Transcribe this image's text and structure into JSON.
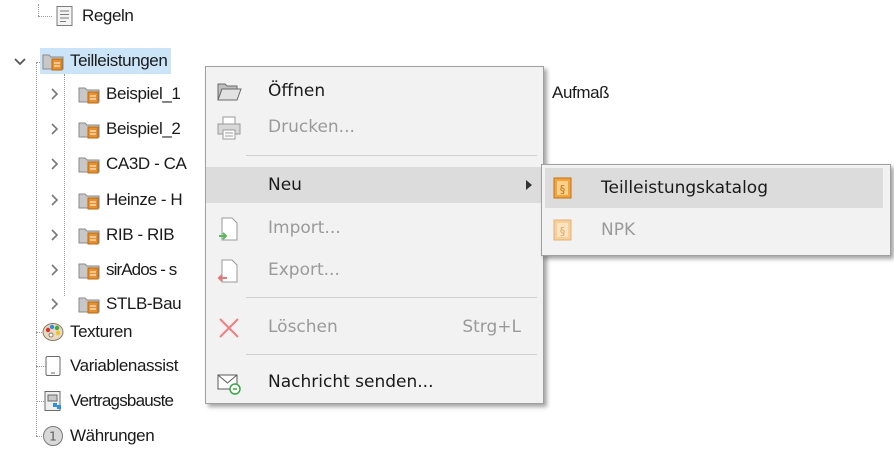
{
  "tree": {
    "items": [
      {
        "label": "Regeln",
        "icon": "rules-icon"
      },
      {
        "label": "Teilleistungen",
        "icon": "folder-icon",
        "selected": true,
        "expanded": true
      },
      {
        "label": "Beispiel_1",
        "icon": "folder-icon"
      },
      {
        "label": "Beispiel_2",
        "icon": "folder-icon"
      },
      {
        "label": "CA3D - CA",
        "icon": "folder-icon"
      },
      {
        "label": "Heinze - H",
        "icon": "folder-icon"
      },
      {
        "label": "RIB - RIB",
        "icon": "folder-icon"
      },
      {
        "label": "sirAdos - s",
        "icon": "folder-icon"
      },
      {
        "label": "STLB-Bau",
        "icon": "folder-icon"
      },
      {
        "label": "Texturen",
        "icon": "palette-icon"
      },
      {
        "label": "Variablenassist",
        "icon": "tablet-icon"
      },
      {
        "label": "Vertragsbauste",
        "icon": "contract-icon"
      },
      {
        "label": "Währungen",
        "icon": "currency-icon"
      }
    ],
    "background_text": "Aufmaß"
  },
  "context_menu": {
    "items": [
      {
        "label": "Öffnen",
        "icon": "open-folder-icon",
        "disabled": false
      },
      {
        "label": "Drucken...",
        "icon": "printer-icon",
        "disabled": true
      },
      {
        "label": "Neu",
        "disabled": false,
        "highlighted": true,
        "has_submenu": true
      },
      {
        "label": "Import...",
        "icon": "import-icon",
        "disabled": true
      },
      {
        "label": "Export...",
        "icon": "export-icon",
        "disabled": true
      },
      {
        "label": "Löschen",
        "icon": "delete-icon",
        "disabled": true,
        "shortcut": "Strg+L"
      },
      {
        "label": "Nachricht senden...",
        "icon": "mail-icon",
        "disabled": false
      }
    ]
  },
  "submenu": {
    "items": [
      {
        "label": "Teilleistungskatalog",
        "icon": "catalog-icon",
        "highlighted": true,
        "disabled": false
      },
      {
        "label": "NPK",
        "icon": "catalog-icon",
        "disabled": true
      }
    ]
  },
  "colors": {
    "selection": "#cce4f7",
    "menu_bg": "#f2f2f2",
    "menu_hover": "#dcdcdc",
    "folder_orange": "#e8902c",
    "disabled_text": "#9a9a9a"
  }
}
